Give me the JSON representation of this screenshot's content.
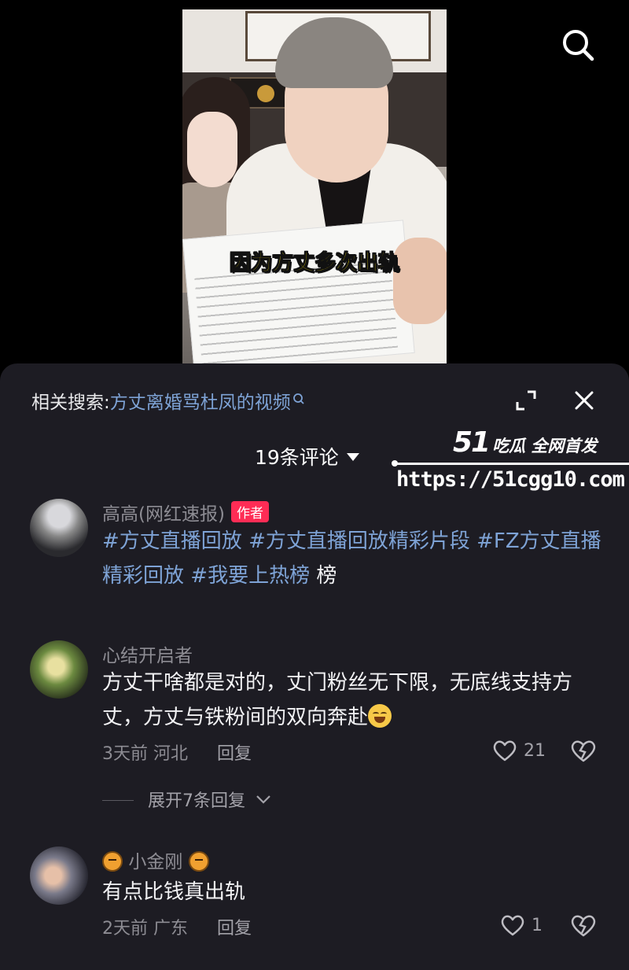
{
  "video": {
    "caption": "因为方丈多次出轨"
  },
  "icons": {
    "search": "search-icon",
    "expand": "expand-icon",
    "close": "close-icon",
    "like": "heart-icon",
    "dislike": "broken-heart-icon"
  },
  "panel": {
    "related_label": "相关搜索:",
    "related_query": "方丈离婚骂杜凤的视频",
    "comment_count": "19条评论"
  },
  "watermark": {
    "brand": "51",
    "slogan": "吃瓜 全网首发",
    "url": "https://51cgg10.com"
  },
  "comments": [
    {
      "username": "高高(网红速报)",
      "badge": "作者",
      "tags": [
        "#方丈直播回放",
        "#方丈直播回放精彩片段",
        "#FZ方丈直播精彩回放",
        "#我要上热榜"
      ],
      "tail": "榜"
    },
    {
      "username": "心结开启者",
      "text": "方丈干啥都是对的，丈门粉丝无下限，无底线支持方丈，方丈与铁粉间的双向奔赴",
      "time": "3天前",
      "location": "河北",
      "reply_label": "回复",
      "likes": "21",
      "expand_label": "展开7条回复"
    },
    {
      "username": "小金刚",
      "text": "有点比钱真出轨",
      "time": "2天前",
      "location": "广东",
      "reply_label": "回复",
      "likes": "1"
    }
  ],
  "colors": {
    "panel_bg": "#1d1c23",
    "tag_blue": "#7ea3d6",
    "badge_red": "#fe2c55",
    "muted": "#8d8c93",
    "caption_yellow": "#f6e100"
  }
}
